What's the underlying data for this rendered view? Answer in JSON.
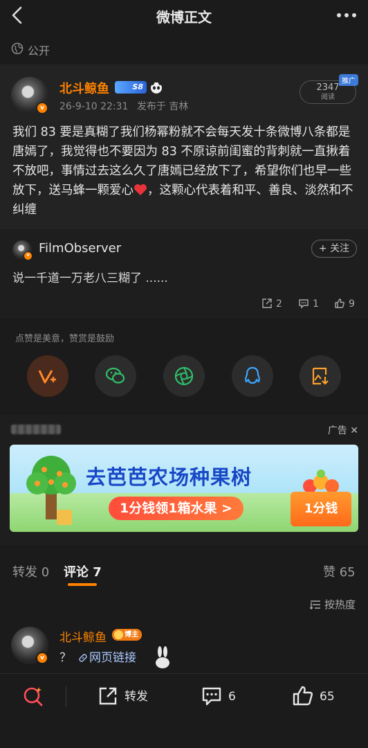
{
  "nav": {
    "title": "微博正文"
  },
  "visibility": {
    "label": "公开"
  },
  "post": {
    "author": "北斗鲸鱼",
    "level_badge": "S8",
    "time": "26-9-10 22:31",
    "location": "发布于 吉林",
    "reads_count": "2347",
    "reads_label": "阅读",
    "promo_tag": "推广",
    "text_before_heart": "我们 83 要是真糊了我们杨幂粉就不会每天发十条微博八条都是唐嫣了，我觉得也不要因为 83 不原谅前闺蜜的背刺就一直揪着不放吧，事情过去这么久了唐嫣已经放下了，希望你们也早一些放下，送马蜂一颗爱心",
    "text_after_heart": "，这颗心代表着和平、善良、淡然和不纠缠"
  },
  "featured_comment": {
    "name": "FilmObserver",
    "follow_label": "+ 关注",
    "text": "说一千道一万老八三糊了 ......",
    "reposts": "2",
    "comments": "1",
    "likes": "9"
  },
  "reward": {
    "hint": "点赞是美意，赞赏是鼓励"
  },
  "ad": {
    "label": "广告",
    "headline": "去芭芭农场种果树",
    "cta": "1分钱领1箱水果 >",
    "box_text": "1分钱"
  },
  "tabs": [
    {
      "label": "转发",
      "count": "0"
    },
    {
      "label": "评论",
      "count": "7"
    },
    {
      "label": "赞",
      "count": "65"
    }
  ],
  "sort": {
    "label": "按热度"
  },
  "reply": {
    "name": "北斗鲸鱼",
    "badge": "博主",
    "text": "？",
    "link_label": "网页链接"
  },
  "bottom": {
    "repost_label": "转发",
    "comment_count": "6",
    "like_count": "65"
  },
  "colors": {
    "accent": "#ff8200",
    "background": "#1b1b1b",
    "card": "#232323"
  }
}
